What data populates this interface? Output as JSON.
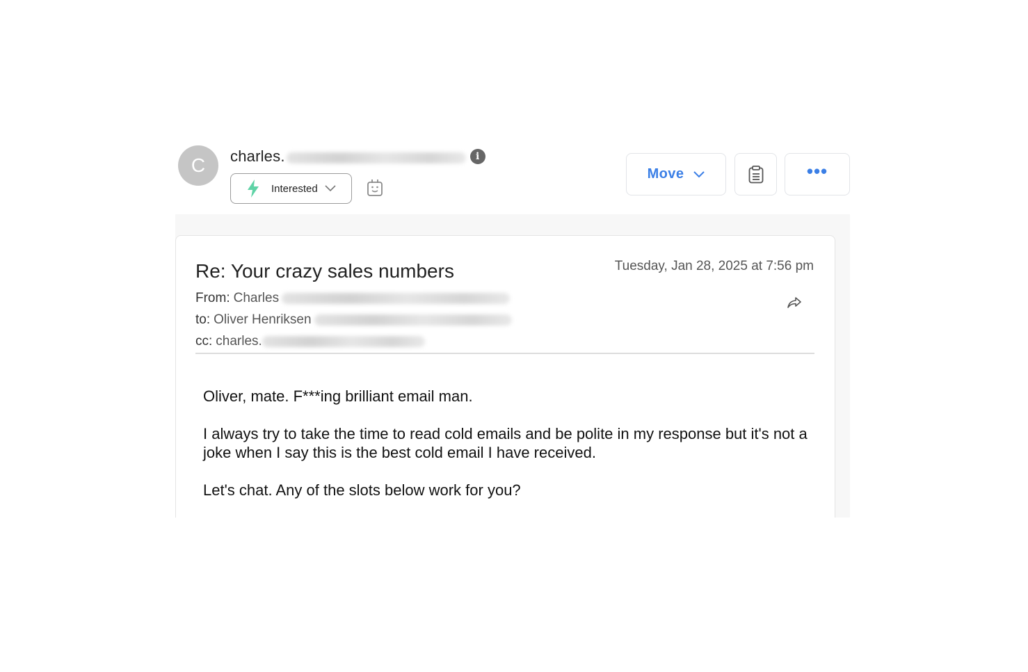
{
  "header": {
    "avatar_initial": "C",
    "sender_name": "charles.",
    "info_icon": "info-icon",
    "status": {
      "label": "Interested",
      "icon": "bolt-icon",
      "icon_color": "#5fd3a6"
    },
    "bot_icon": "bot-icon"
  },
  "toolbar": {
    "move_label": "Move",
    "notes_icon": "clipboard-icon",
    "more_label": "•••",
    "accent": "#3b7fe6"
  },
  "email": {
    "subject": "Re: Your crazy sales numbers",
    "date": "Tuesday, Jan 28, 2025 at 7:56 pm",
    "from_label": "From:",
    "from_name": "Charles",
    "to_label": "to:",
    "to_name": "Oliver Henriksen",
    "cc_label": "cc:",
    "cc_name": "charles.",
    "body": [
      "Oliver, mate. F***ing brilliant email man.",
      "I always try to take the time to read cold emails and be polite in my response but it's not a joke when I say this is the best cold email I have received.",
      "Let's chat. Any of the slots below work for you?"
    ]
  }
}
